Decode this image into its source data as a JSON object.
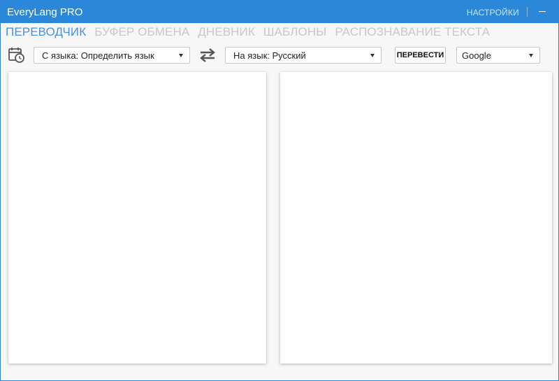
{
  "window": {
    "title": "EveryLang PRO",
    "settings_label": "НАСТРОЙКИ",
    "accent_color": "#2b88d8"
  },
  "tabs": [
    {
      "label": "ПЕРЕВОДЧИК",
      "active": true
    },
    {
      "label": "БУФЕР ОБМЕНА",
      "active": false
    },
    {
      "label": "ДНЕВНИК",
      "active": false
    },
    {
      "label": "ШАБЛОНЫ",
      "active": false
    },
    {
      "label": "РАСПОЗНАВАНИЕ ТЕКСТА",
      "active": false
    }
  ],
  "toolbar": {
    "history_icon": "calendar-clock-icon",
    "source_language": "С языка: Определить язык",
    "swap_icon": "swap-arrows-icon",
    "target_language": "На язык: Русский",
    "translate_label": "ПЕРЕВЕСТИ",
    "service": "Google"
  },
  "panels": {
    "source_text": "",
    "translated_text": ""
  }
}
